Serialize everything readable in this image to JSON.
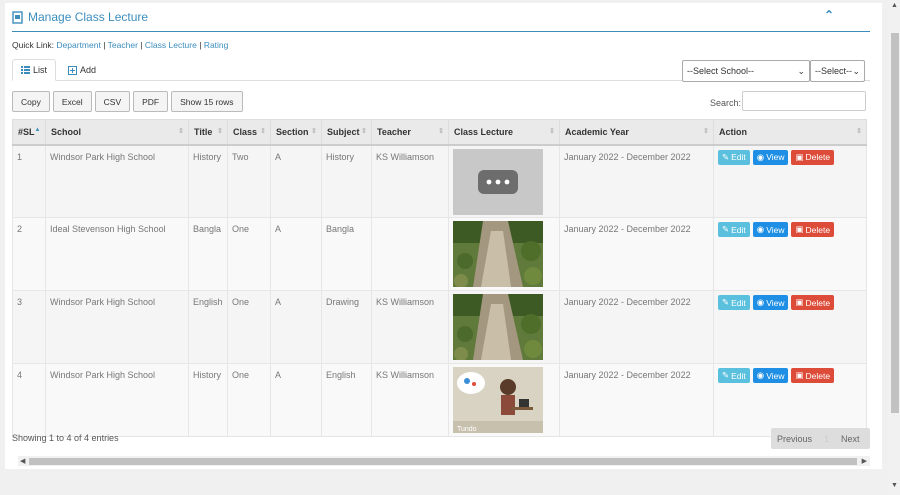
{
  "header": {
    "title": "Manage Class Lecture"
  },
  "quick_links": {
    "label": "Quick Link:",
    "links": [
      "Department",
      "Teacher",
      "Class Lecture",
      "Rating"
    ]
  },
  "tabs": {
    "list_label": "List",
    "add_label": "Add"
  },
  "filters": {
    "school_select": "--Select School--",
    "other_select": "--Select--"
  },
  "export_buttons": {
    "copy": "Copy",
    "excel": "Excel",
    "csv": "CSV",
    "pdf": "PDF",
    "show_rows": "Show 15 rows"
  },
  "search": {
    "label": "Search:",
    "value": ""
  },
  "table": {
    "columns": [
      "#SL",
      "School",
      "Title",
      "Class",
      "Section",
      "Subject",
      "Teacher",
      "Class Lecture",
      "Academic Year",
      "Action"
    ],
    "rows": [
      {
        "sl": "1",
        "school": "Windsor Park High School",
        "title": "History",
        "class": "Two",
        "section": "A",
        "subject": "History",
        "teacher": "KS Williamson",
        "lecture": "placeholder",
        "year": "January 2022 - December 2022"
      },
      {
        "sl": "2",
        "school": "Ideal Stevenson High School",
        "title": "Bangla",
        "class": "One",
        "section": "A",
        "subject": "Bangla",
        "teacher": "",
        "lecture": "path-photo",
        "year": "January 2022 - December 2022"
      },
      {
        "sl": "3",
        "school": "Windsor Park High School",
        "title": "English",
        "class": "One",
        "section": "A",
        "subject": "Drawing",
        "teacher": "KS Williamson",
        "lecture": "path-photo",
        "year": "January 2022 - December 2022"
      },
      {
        "sl": "4",
        "school": "Windsor Park High School",
        "title": "History",
        "class": "One",
        "section": "A",
        "subject": "English",
        "teacher": "KS Williamson",
        "lecture": "cartoon",
        "year": "January 2022 - December 2022"
      }
    ],
    "actions": {
      "edit": "Edit",
      "view": "View",
      "delete": "Delete"
    },
    "thumb_caption": "Tundo"
  },
  "footer": {
    "info": "Showing 1 to 4 of 4 entries",
    "prev": "Previous",
    "page": "1",
    "next": "Next"
  },
  "colors": {
    "accent": "#3c8dbc",
    "edit": "#5bc0de",
    "view": "#1e8fe4",
    "delete": "#dd4b39"
  }
}
